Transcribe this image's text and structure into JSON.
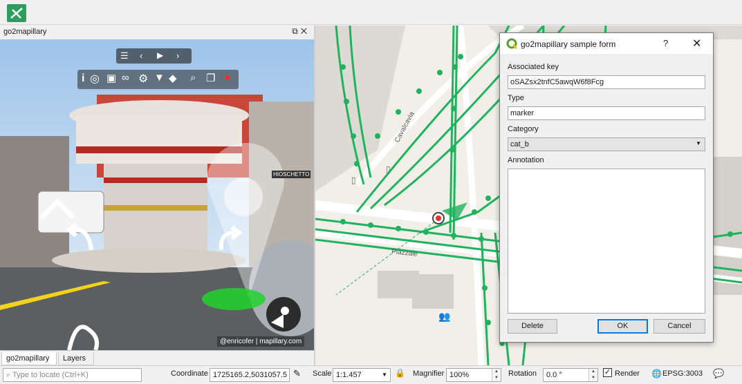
{
  "toolbar": {
    "plugin_icon": "go2mapillary-icon"
  },
  "dock": {
    "title": "go2mapillary",
    "float_icon": "float-icon",
    "close_label": "✕",
    "attribution": "@enricofer | mapillary.com",
    "sign_text": "HIOSCHETTO",
    "tabs": [
      "go2mapillary",
      "Layers"
    ]
  },
  "map": {
    "street_labels": [
      "Cavalcavia",
      "Piazzale"
    ]
  },
  "dialog": {
    "title": "go2mapillary sample form",
    "help_label": "?",
    "close_label": "✕",
    "associated_key_label": "Associated key",
    "associated_key_value": "oSAZsx2tnfC5awqW6f8Fcg",
    "type_label": "Type",
    "type_value": "marker",
    "category_label": "Category",
    "category_value": "cat_b",
    "annotation_label": "Annotation",
    "annotation_value": "",
    "delete_label": "Delete",
    "ok_label": "OK",
    "cancel_label": "Cancel"
  },
  "status": {
    "locate_placeholder": "Type to locate (Ctrl+K)",
    "coordinate_label": "Coordinate",
    "coordinate_value": "1725165.2,5031057.5",
    "scale_label": "Scale",
    "scale_value": "1:1.457",
    "magnifier_label": "Magnifier",
    "magnifier_value": "100%",
    "rotation_label": "Rotation",
    "rotation_value": "0.0 °",
    "render_label": "Render",
    "render_checked": true,
    "crs_label": "EPSG:3003"
  },
  "colors": {
    "route_green": "#1fb35f",
    "accent_blue": "#0078d7",
    "qgis_green": "#5a9a2e"
  }
}
